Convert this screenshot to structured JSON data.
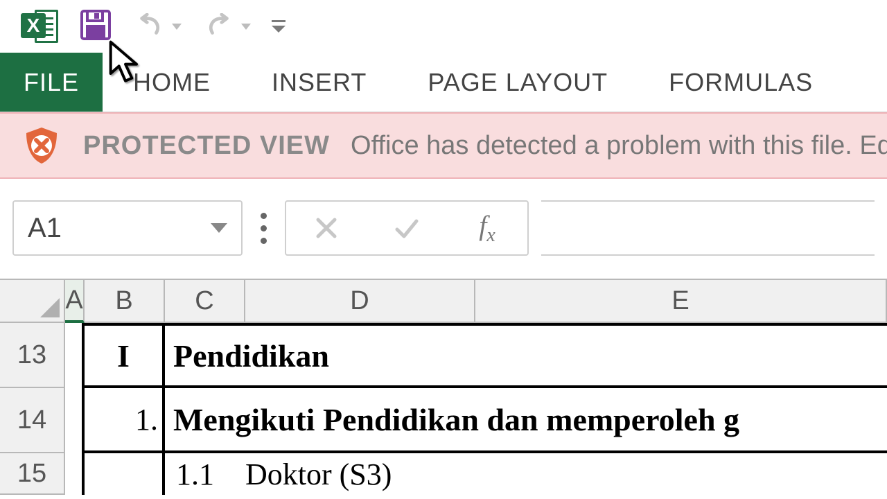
{
  "qat": {
    "app_icon_letter": "X"
  },
  "ribbon": {
    "tabs": {
      "file": "FILE",
      "home": "HOME",
      "insert": "INSERT",
      "page_layout": "PAGE LAYOUT",
      "formulas": "FORMULAS"
    }
  },
  "protected_view": {
    "title": "PROTECTED VIEW",
    "message": "Office has detected a problem with this file. Edi"
  },
  "formula_bar": {
    "name_box": "A1",
    "fx_label": "fx",
    "formula_value": ""
  },
  "grid": {
    "columns": {
      "A": "A",
      "B": "B",
      "C": "C",
      "D": "D",
      "E": "E"
    },
    "rows": {
      "r13": {
        "num": "13",
        "B": "I",
        "rest": "Pendidikan"
      },
      "r14": {
        "num": "14",
        "B": "1.",
        "rest": "Mengikuti Pendidikan dan memperoleh g"
      },
      "r15": {
        "num": "15",
        "C_num": "1.1",
        "D": "Doktor (S3)"
      }
    }
  }
}
